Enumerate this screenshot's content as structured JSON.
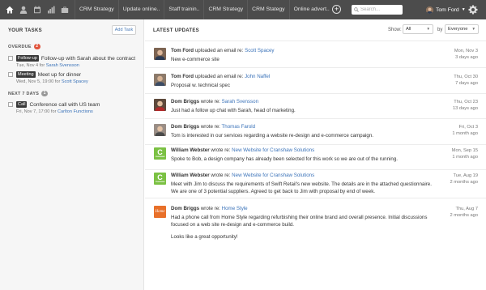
{
  "nav": {
    "icons": [
      "home-icon",
      "contacts-icon",
      "calendar-icon",
      "reports-icon",
      "briefcase-icon"
    ],
    "tabs": [
      "CRM Strategy",
      "Update online..",
      "Staff trainin..",
      "CRM Strategy",
      "CRM Stategy",
      "Online advert.."
    ]
  },
  "search": {
    "placeholder": "Search..."
  },
  "user": {
    "name": "Tom Ford"
  },
  "tasks": {
    "title": "YOUR TASKS",
    "add_label": "Add Task",
    "overdue": {
      "label": "OVERDUE",
      "count": "2",
      "items": [
        {
          "type": "Follow-up",
          "title": "Follow-up with Sarah about the contract",
          "due": "Tue, Nov 4 for",
          "who": "Sarah Svensson"
        },
        {
          "type": "Meeting",
          "title": "Meet up for dinner",
          "due": "Wed, Nov 5, 19:00 for",
          "who": "Scott Spacey"
        }
      ]
    },
    "next": {
      "label": "NEXT 7 DAYS",
      "count": "1",
      "items": [
        {
          "type": "Call",
          "title": "Conference call with US team",
          "due": "Fri, Nov 7, 17:00 for",
          "who": "Carlton Functions"
        }
      ]
    }
  },
  "updates": {
    "title": "LATEST UPDATES",
    "show_label": "Show:",
    "show_value": "All",
    "by_label": "by",
    "by_value": "Everyone",
    "items": [
      {
        "author": "Tom Ford",
        "action": "uploaded an email re:",
        "target": "Scott Spacey",
        "body": "New e-commerce site",
        "date": "Mon, Nov 3",
        "ago": "3 days ago",
        "pic": "photo"
      },
      {
        "author": "Tom Ford",
        "action": "uploaded an email re:",
        "target": "John Naffel",
        "body": "Proposal w. technical spec",
        "date": "Thu, Oct 30",
        "ago": "7 days ago",
        "pic": "photo"
      },
      {
        "author": "Dom Briggs",
        "action": "wrote re:",
        "target": "Sarah Svensson",
        "body": "Just had a follow up chat with Sarah, head of marketing.",
        "date": "Thu, Oct 23",
        "ago": "13 days ago",
        "pic": "photo"
      },
      {
        "author": "Dom Briggs",
        "action": "wrote re:",
        "target": "Thomas Farold",
        "body": "Tom is interested in our services regarding a website re-design and e-commerce campaign.",
        "date": "Fri, Oct 3",
        "ago": "1 month ago",
        "pic": "photo"
      },
      {
        "author": "William Webster",
        "action": "wrote re:",
        "target": "New Website for Cranshaw Solutions",
        "body": "Spoke to Bob, a design company has already been selected for this work so we are out of the running.",
        "date": "Mon, Sep 15",
        "ago": "1 month ago",
        "pic": "logo-c"
      },
      {
        "author": "William Webster",
        "action": "wrote re:",
        "target": "New Website for Cranshaw Solutions",
        "body": "Meet with Jim to discuss the requirements of Swift Retail's new website. The details are in the attached questionnaire. We are one of 3 potential suppliers. Agreed to get back to Jim with proposal by end of week.",
        "date": "Tue, Aug 19",
        "ago": "2 months ago",
        "pic": "logo-c"
      },
      {
        "author": "Dom Briggs",
        "action": "wrote re:",
        "target": "Home Style",
        "body": "Had a phone call from Home Style regarding refurbishing their online brand and overall presence. Initial discussions focused on a web site re-design and e-commerce build.",
        "body2": "Looks like a great opportunity!",
        "date": "Thu, Aug 7",
        "ago": "2 months ago",
        "pic": "logo-hs"
      }
    ]
  },
  "logos": {
    "c_letter": "C",
    "c_small": "CRANSHAW",
    "hs_text": "Home Style"
  },
  "colors": {
    "topbar": "#4c4c4c",
    "link": "#3b73b9",
    "overdue": "#e0543c",
    "green_logo": "#7bc143",
    "orange_logo": "#e8702a"
  }
}
